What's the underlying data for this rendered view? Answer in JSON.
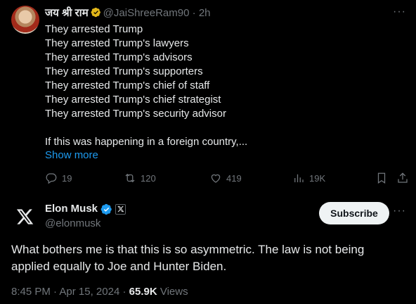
{
  "parent_tweet": {
    "display_name": "जय श्री राम",
    "handle": "@JaiShreeRam90",
    "time": "2h",
    "lines": [
      "They arrested Trump",
      "They arrested Trump's lawyers",
      "They arrested Trump's advisors",
      "They arrested Trump's supporters",
      "They arrested Trump's chief of staff",
      "They arrested Trump's chief strategist",
      "They arrested Trump's security advisor"
    ],
    "last_line": "If this was happening in a foreign country,...",
    "show_more": "Show more",
    "actions": {
      "replies": "19",
      "reposts": "120",
      "likes": "419",
      "views": "19K"
    },
    "icons": [
      "reply-icon",
      "repost-icon",
      "like-icon",
      "views-icon",
      "bookmark-icon",
      "share-icon"
    ]
  },
  "main_tweet": {
    "display_name": "Elon Musk",
    "handle": "@elonmusk",
    "subscribe_label": "Subscribe",
    "text": "What bothers me is that this is so asymmetric. The law is not being applied equally to Joe and Hunter Biden.",
    "time": "8:45 PM",
    "date": "Apr 15, 2024",
    "views_count": "65.9K",
    "views_label": "Views"
  },
  "colors": {
    "background": "#000000",
    "text": "#e7e9ea",
    "muted": "#71767b",
    "link": "#1d9bf0",
    "verified_blue": "#1d9bf0",
    "verified_gold": "#e2b719"
  }
}
